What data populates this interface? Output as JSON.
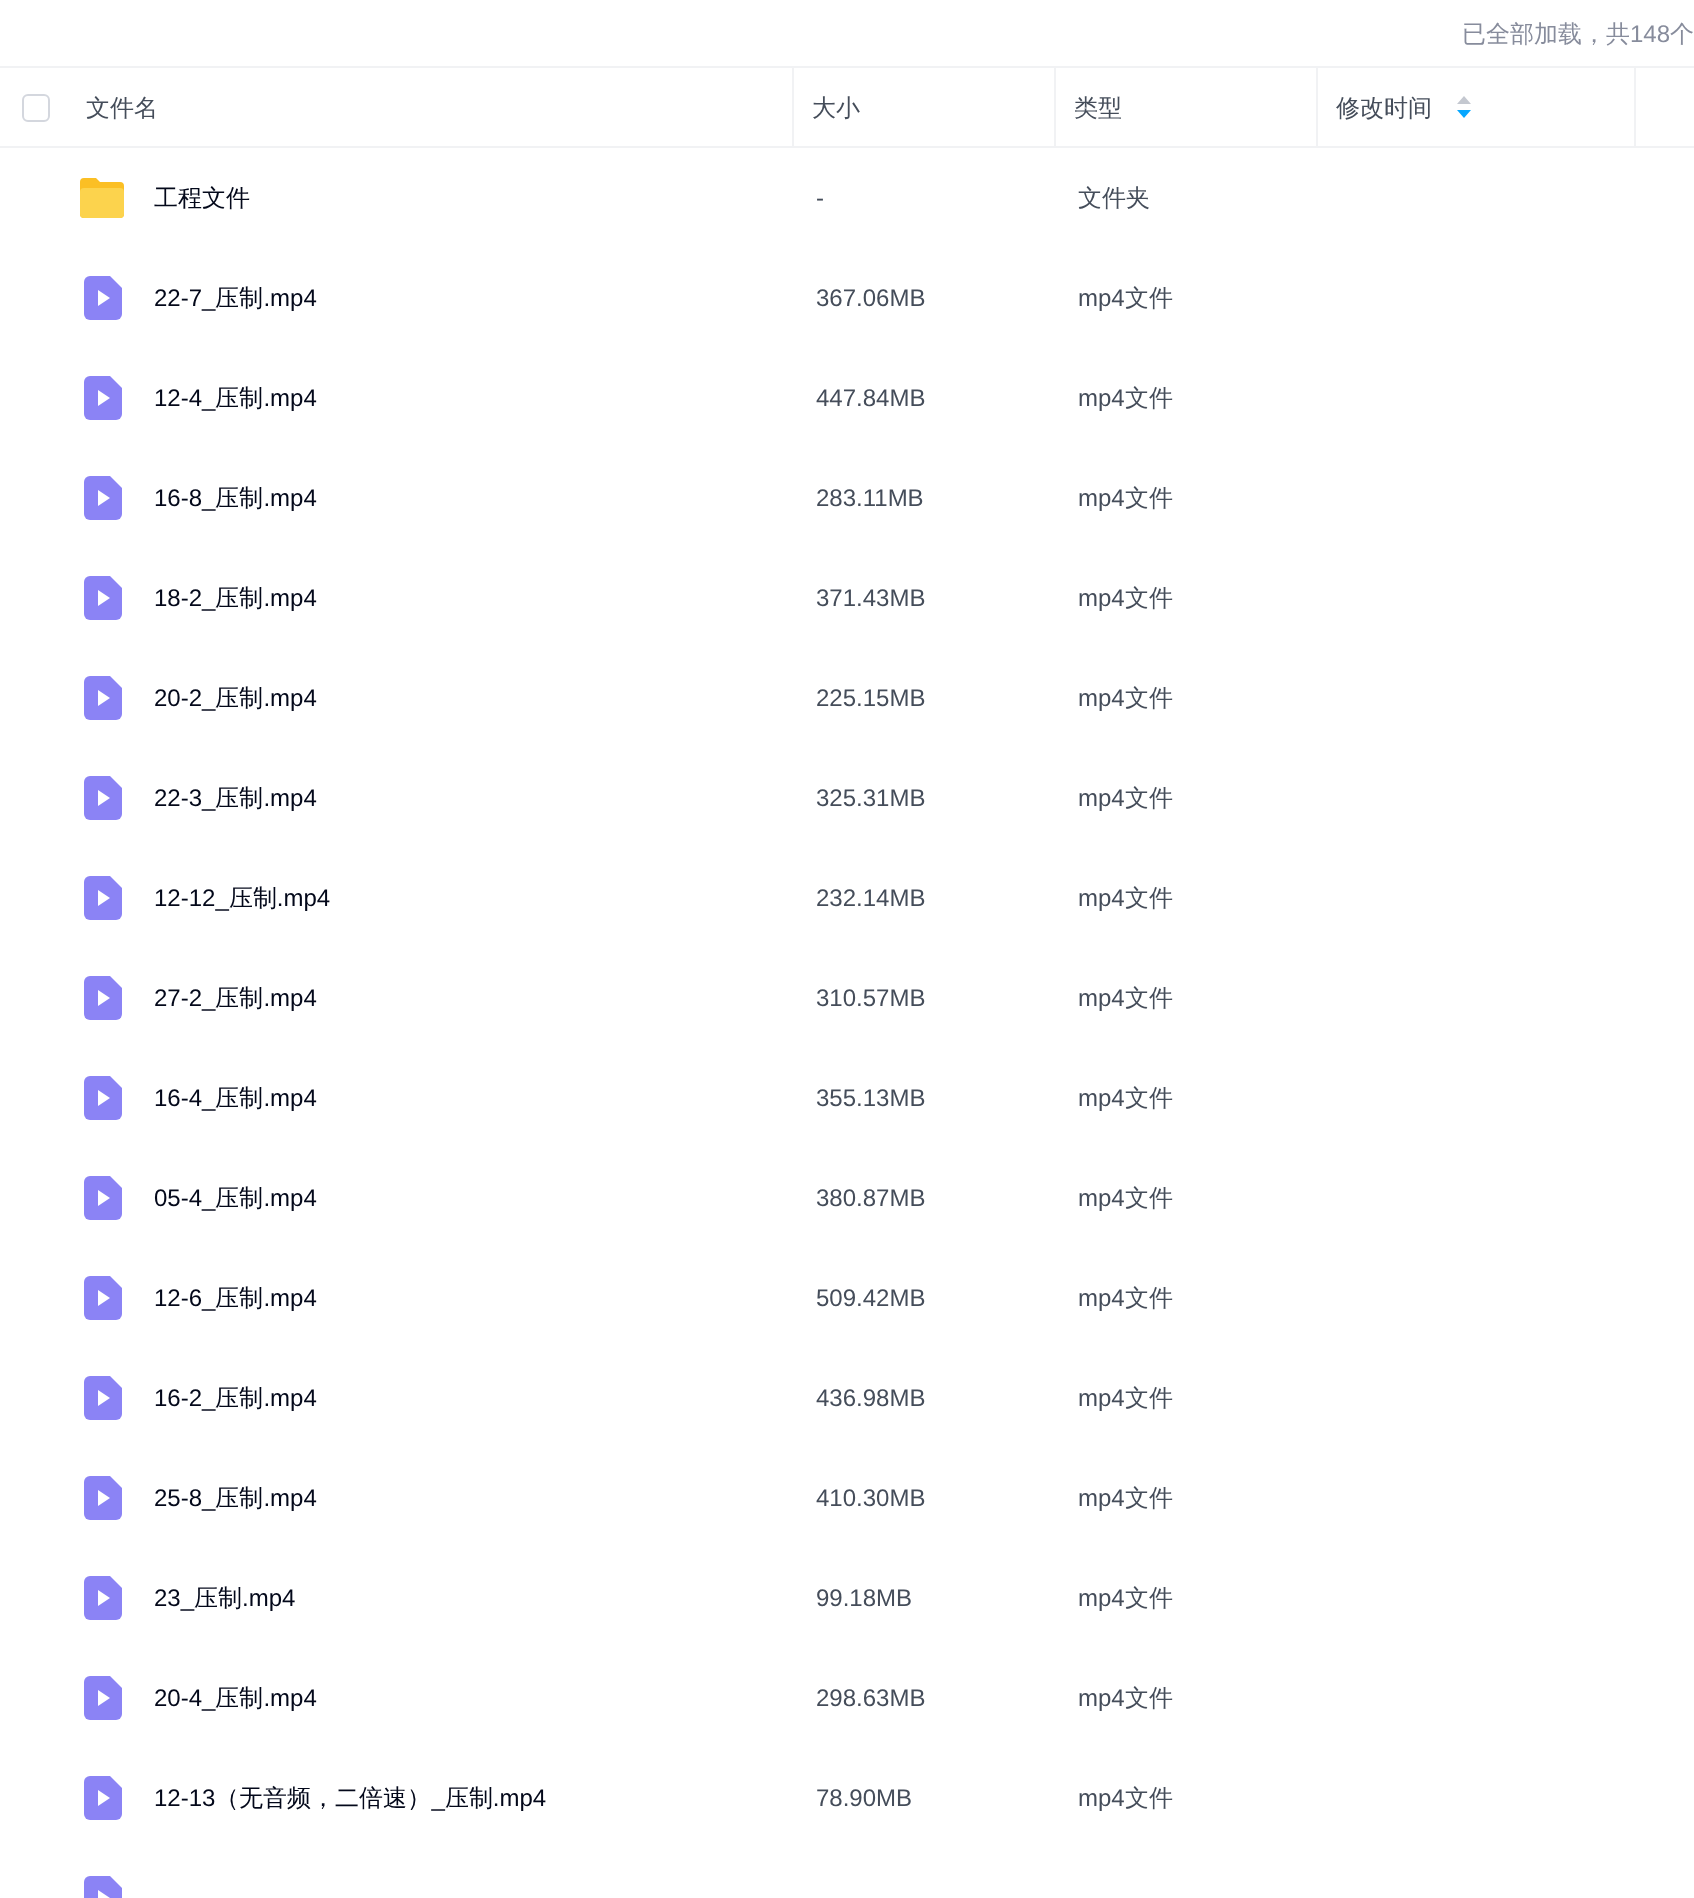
{
  "status": "已全部加载，共148个",
  "header": {
    "checked": false,
    "columns": [
      {
        "label": "文件名"
      },
      {
        "label": "大小"
      },
      {
        "label": "类型"
      },
      {
        "label": "修改时间",
        "sortable": true,
        "sort_descending": true
      }
    ]
  },
  "rows": [
    {
      "kind": "folder",
      "name": "工程文件",
      "size": "-",
      "type": "文件夹"
    },
    {
      "kind": "video",
      "name": "22-7_压制.mp4",
      "size": "367.06MB",
      "type": "mp4文件"
    },
    {
      "kind": "video",
      "name": "12-4_压制.mp4",
      "size": "447.84MB",
      "type": "mp4文件"
    },
    {
      "kind": "video",
      "name": "16-8_压制.mp4",
      "size": "283.11MB",
      "type": "mp4文件"
    },
    {
      "kind": "video",
      "name": "18-2_压制.mp4",
      "size": "371.43MB",
      "type": "mp4文件"
    },
    {
      "kind": "video",
      "name": "20-2_压制.mp4",
      "size": "225.15MB",
      "type": "mp4文件"
    },
    {
      "kind": "video",
      "name": "22-3_压制.mp4",
      "size": "325.31MB",
      "type": "mp4文件"
    },
    {
      "kind": "video",
      "name": "12-12_压制.mp4",
      "size": "232.14MB",
      "type": "mp4文件"
    },
    {
      "kind": "video",
      "name": "27-2_压制.mp4",
      "size": "310.57MB",
      "type": "mp4文件"
    },
    {
      "kind": "video",
      "name": "16-4_压制.mp4",
      "size": "355.13MB",
      "type": "mp4文件"
    },
    {
      "kind": "video",
      "name": "05-4_压制.mp4",
      "size": "380.87MB",
      "type": "mp4文件"
    },
    {
      "kind": "video",
      "name": "12-6_压制.mp4",
      "size": "509.42MB",
      "type": "mp4文件"
    },
    {
      "kind": "video",
      "name": "16-2_压制.mp4",
      "size": "436.98MB",
      "type": "mp4文件"
    },
    {
      "kind": "video",
      "name": "25-8_压制.mp4",
      "size": "410.30MB",
      "type": "mp4文件"
    },
    {
      "kind": "video",
      "name": "23_压制.mp4",
      "size": "99.18MB",
      "type": "mp4文件"
    },
    {
      "kind": "video",
      "name": "20-4_压制.mp4",
      "size": "298.63MB",
      "type": "mp4文件"
    },
    {
      "kind": "video",
      "name": "12-13（无音频，二倍速）_压制.mp4",
      "size": "78.90MB",
      "type": "mp4文件"
    },
    {
      "kind": "video"
    }
  ]
}
